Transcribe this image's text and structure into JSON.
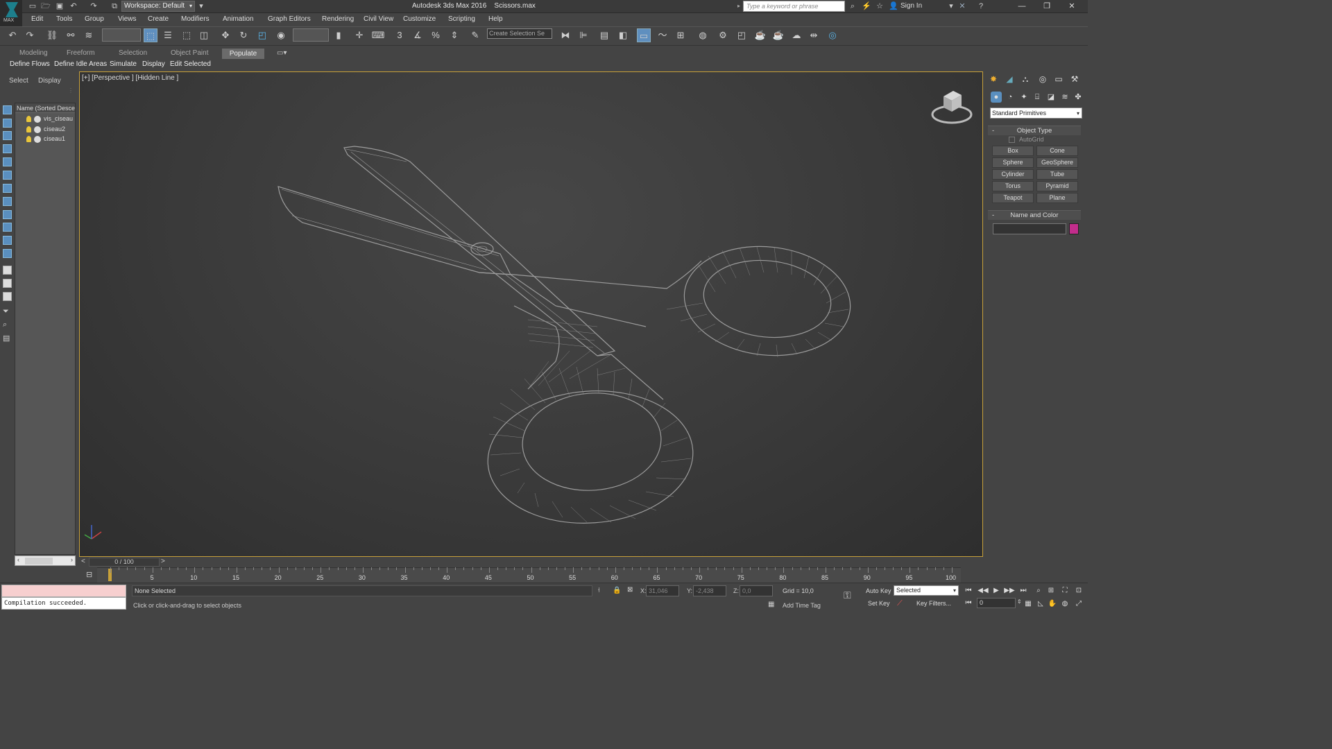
{
  "app": {
    "logo_text": "MAX",
    "title": "Autodesk 3ds Max 2016",
    "filename": "Scissors.max",
    "workspace": "Workspace: Default",
    "search_placeholder": "Type a keyword or phrase",
    "signin": "Sign In"
  },
  "menu": [
    "Edit",
    "Tools",
    "Group",
    "Views",
    "Create",
    "Modifiers",
    "Animation",
    "Graph Editors",
    "Rendering",
    "Civil View",
    "Customize",
    "Scripting",
    "Help"
  ],
  "toolbar": {
    "selection_set_placeholder": "Create Selection Se",
    "snap_3_label": "3",
    "snap_percent_label": "%"
  },
  "ribbon": {
    "tabs": [
      "Modeling",
      "Freeform",
      "Selection",
      "Object Paint",
      "Populate"
    ],
    "buttons": [
      "Define Flows",
      "Define Idle Areas",
      "Simulate",
      "Display",
      "Edit Selected"
    ]
  },
  "scene_explorer": {
    "tabs": [
      "Select",
      "Display"
    ],
    "column_header": "Name (Sorted Descending)",
    "objects": [
      "vis_ciseau",
      "ciseau2",
      "ciseau1"
    ]
  },
  "viewport": {
    "label": "[+] [Perspective ] [Hidden Line ]",
    "shading": "Hidden Line",
    "view": "Perspective"
  },
  "command_panel": {
    "category": "Standard Primitives",
    "object_type_title": "Object Type",
    "autogrid": "AutoGrid",
    "primitives": [
      "Box",
      "Cone",
      "Sphere",
      "GeoSphere",
      "Cylinder",
      "Tube",
      "Torus",
      "Pyramid",
      "Teapot",
      "Plane"
    ],
    "name_color_title": "Name and Color",
    "object_color": "#c22d8c"
  },
  "timeline": {
    "frame_display": "0 / 100",
    "ticks": [
      "5",
      "10",
      "15",
      "20",
      "25",
      "30",
      "35",
      "40",
      "45",
      "50",
      "55",
      "60",
      "65",
      "70",
      "75",
      "80",
      "85",
      "90",
      "95",
      "100"
    ]
  },
  "status": {
    "maxscript_output": "Compilation succeeded.",
    "selection": "None Selected",
    "prompt": "Click or click-and-drag to select objects",
    "x_label": "X:",
    "x_value": "31,046",
    "y_label": "Y:",
    "y_value": "-2,438",
    "z_label": "Z:",
    "z_value": "0,0",
    "grid": "Grid = 10,0",
    "add_time_tag": "Add Time Tag",
    "auto_key": "Auto Key",
    "set_key": "Set Key",
    "key_mode": "Selected",
    "key_filters": "Key Filters...",
    "current_frame": "0"
  }
}
